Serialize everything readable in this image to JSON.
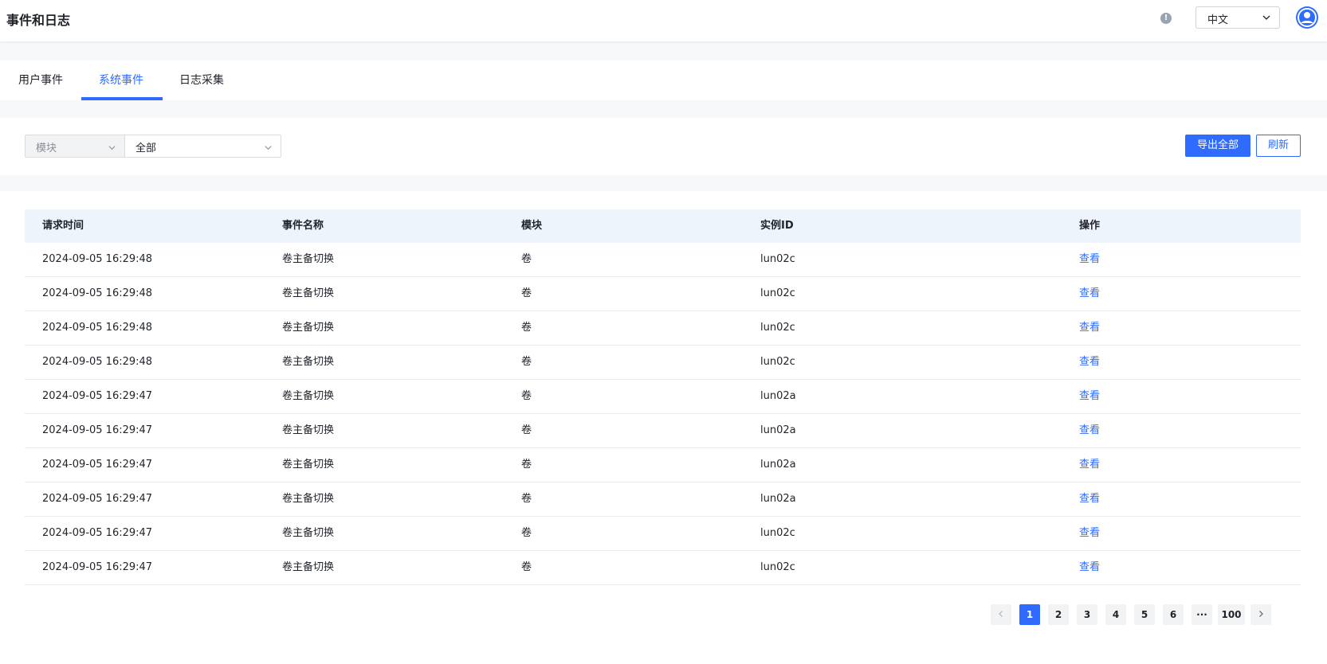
{
  "header": {
    "title": "事件和日志",
    "info_icon": "!",
    "language": "中文"
  },
  "tabs": [
    {
      "label": "用户事件",
      "active": false
    },
    {
      "label": "系统事件",
      "active": true
    },
    {
      "label": "日志采集",
      "active": false
    }
  ],
  "filter": {
    "field_label": "模块",
    "field_value": "全部"
  },
  "actions": {
    "export_label": "导出全部",
    "refresh_label": "刷新"
  },
  "table": {
    "columns": [
      "请求时间",
      "事件名称",
      "模块",
      "实例ID",
      "操作"
    ],
    "rows": [
      [
        "2024-09-05 16:29:48",
        "卷主备切换",
        "卷",
        "lun02c",
        "查看"
      ],
      [
        "2024-09-05 16:29:48",
        "卷主备切换",
        "卷",
        "lun02c",
        "查看"
      ],
      [
        "2024-09-05 16:29:48",
        "卷主备切换",
        "卷",
        "lun02c",
        "查看"
      ],
      [
        "2024-09-05 16:29:48",
        "卷主备切换",
        "卷",
        "lun02c",
        "查看"
      ],
      [
        "2024-09-05 16:29:47",
        "卷主备切换",
        "卷",
        "lun02a",
        "查看"
      ],
      [
        "2024-09-05 16:29:47",
        "卷主备切换",
        "卷",
        "lun02a",
        "查看"
      ],
      [
        "2024-09-05 16:29:47",
        "卷主备切换",
        "卷",
        "lun02a",
        "查看"
      ],
      [
        "2024-09-05 16:29:47",
        "卷主备切换",
        "卷",
        "lun02a",
        "查看"
      ],
      [
        "2024-09-05 16:29:47",
        "卷主备切换",
        "卷",
        "lun02c",
        "查看"
      ],
      [
        "2024-09-05 16:29:47",
        "卷主备切换",
        "卷",
        "lun02c",
        "查看"
      ]
    ]
  },
  "pagination": {
    "pages": [
      "1",
      "2",
      "3",
      "4",
      "5",
      "6",
      "···",
      "100"
    ],
    "current": "1"
  },
  "colors": {
    "accent": "#2f6bff",
    "header_row_bg": "#eef4fc",
    "page_bg": "#f7f8fa"
  }
}
